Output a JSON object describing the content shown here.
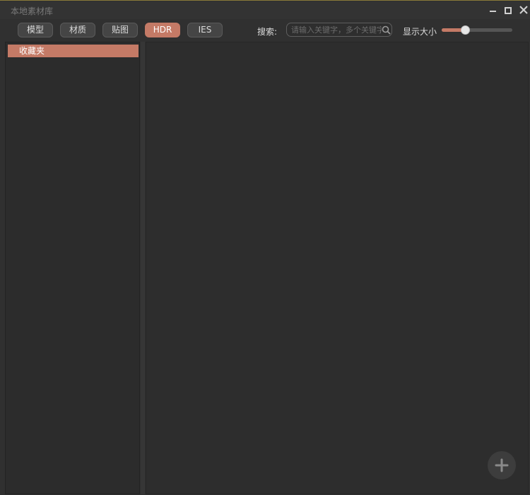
{
  "window": {
    "title": "本地素材库"
  },
  "toolbar": {
    "tabs": [
      {
        "label": "模型"
      },
      {
        "label": "材质"
      },
      {
        "label": "贴图"
      },
      {
        "label": "HDR"
      },
      {
        "label": "IES"
      }
    ],
    "active_tab": "HDR",
    "search_label": "搜索:",
    "search_placeholder": "请输入关键字，多个关键字",
    "search_value": "",
    "size_label": "显示大小",
    "size_value": 0.33
  },
  "sidebar": {
    "items": [
      {
        "label": "收藏夹",
        "selected": true
      }
    ]
  },
  "icons": {
    "search": "search-icon",
    "minimize": "minimize-icon",
    "maximize": "maximize-icon",
    "close": "close-icon",
    "add": "plus-icon"
  },
  "colors": {
    "accent": "#c47a66",
    "background": "#303030",
    "panel": "#2c2c2c"
  }
}
